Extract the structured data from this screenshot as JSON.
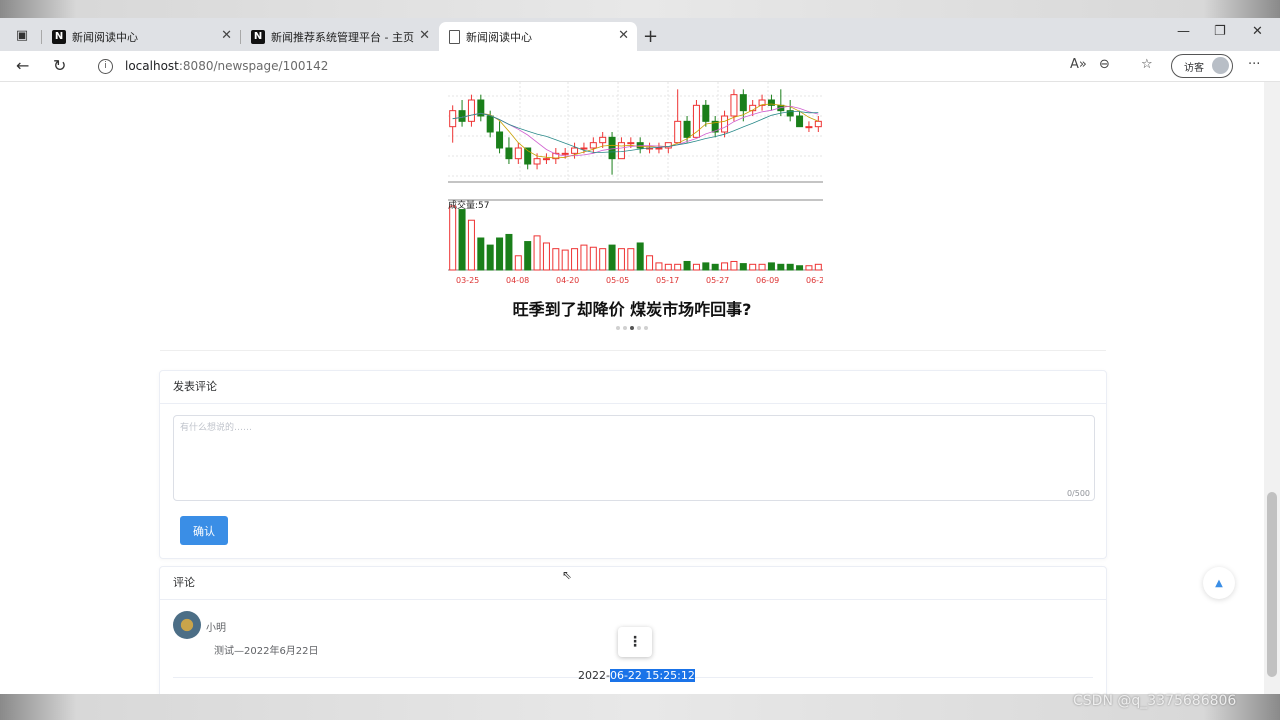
{
  "browser": {
    "tabs": [
      {
        "title": "新闻阅读中心",
        "favicon": "notion-icon",
        "active": false
      },
      {
        "title": "新闻推荐系统管理平台 - 主页",
        "favicon": "notion-icon",
        "active": false
      },
      {
        "title": "新闻阅读中心",
        "favicon": "document-icon",
        "active": true
      }
    ],
    "url_host": "localhost",
    "url_path": ":8080/newspage/100142",
    "visitor_label": "访客"
  },
  "stock_chart": {
    "volume_label": "成交量:57",
    "x_ticks": [
      "03-25",
      "04-08",
      "04-20",
      "05-05",
      "05-17",
      "05-27",
      "06-09",
      "06-2"
    ],
    "candles_ohlc": [
      [
        30,
        34,
        27,
        33
      ],
      [
        33,
        35,
        30,
        31
      ],
      [
        31,
        36,
        30,
        35
      ],
      [
        35,
        36,
        31,
        32
      ],
      [
        32,
        33,
        28,
        29
      ],
      [
        29,
        31,
        25,
        26
      ],
      [
        26,
        28,
        23,
        24
      ],
      [
        24,
        27,
        23,
        26
      ],
      [
        26,
        26,
        22,
        23
      ],
      [
        23,
        25,
        22,
        24
      ],
      [
        24,
        25,
        23,
        24
      ],
      [
        24,
        26,
        23,
        25
      ],
      [
        25,
        26,
        24,
        25
      ],
      [
        25,
        27,
        24,
        26
      ],
      [
        26,
        27,
        25,
        26
      ],
      [
        26,
        28,
        25,
        27
      ],
      [
        27,
        29,
        26,
        28
      ],
      [
        28,
        29,
        21,
        24
      ],
      [
        24,
        28,
        24,
        27
      ],
      [
        27,
        28,
        26,
        27
      ],
      [
        27,
        28,
        25,
        26
      ],
      [
        26,
        27,
        25,
        26
      ],
      [
        26,
        27,
        25,
        26
      ],
      [
        26,
        27,
        25,
        27
      ],
      [
        27,
        37,
        27,
        31
      ],
      [
        31,
        32,
        27,
        28
      ],
      [
        28,
        35,
        28,
        34
      ],
      [
        34,
        35,
        30,
        31
      ],
      [
        31,
        32,
        28,
        29
      ],
      [
        29,
        33,
        28,
        32
      ],
      [
        32,
        37,
        31,
        36
      ],
      [
        36,
        37,
        31,
        33
      ],
      [
        33,
        35,
        32,
        34
      ],
      [
        34,
        36,
        33,
        35
      ],
      [
        35,
        36,
        33,
        34
      ],
      [
        34,
        37,
        32,
        33
      ],
      [
        33,
        35,
        31,
        32
      ],
      [
        32,
        33,
        30,
        30
      ],
      [
        30,
        31,
        29,
        30
      ],
      [
        30,
        32,
        29,
        31
      ]
    ],
    "volumes": [
      90,
      85,
      70,
      45,
      35,
      45,
      50,
      20,
      40,
      48,
      38,
      30,
      28,
      30,
      35,
      32,
      30,
      35,
      30,
      30,
      38,
      20,
      10,
      8,
      8,
      12,
      8,
      10,
      8,
      10,
      12,
      9,
      8,
      8,
      10,
      8,
      8,
      6,
      6,
      8
    ]
  },
  "article": {
    "carousel_title": "旺季到了却降价 煤炭市场咋回事?"
  },
  "comment_form": {
    "header": "发表评论",
    "placeholder": "有什么想说的……",
    "counter": "0/500",
    "submit_label": "确认"
  },
  "comments": {
    "header": "评论",
    "items": [
      {
        "user": "小明",
        "text": "测试—2022年6月22日",
        "time_prefix": "2022-",
        "time_selected": "06-22 15:25:12"
      }
    ]
  },
  "watermark": "CSDN @q_3375686806"
}
